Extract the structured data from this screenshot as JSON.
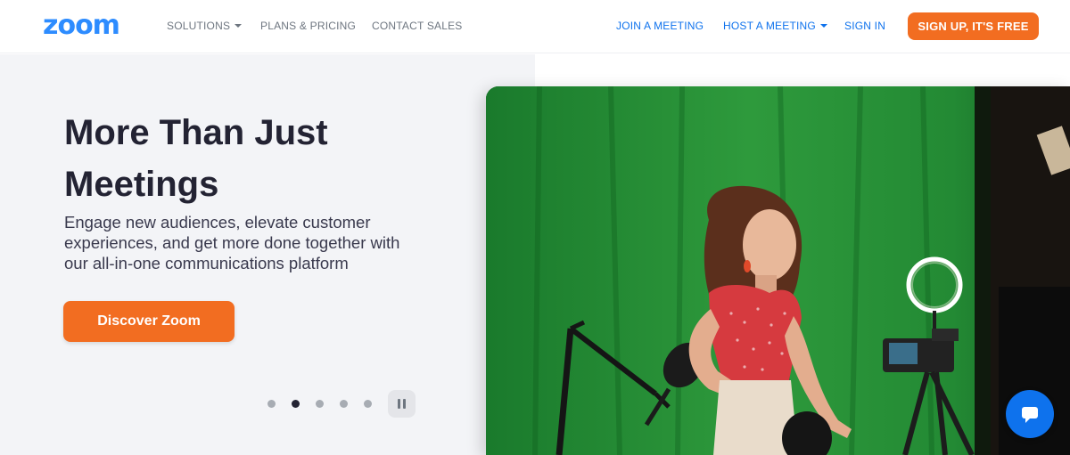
{
  "nav": {
    "logo": "zoom",
    "solutions": "SOLUTIONS",
    "plans": "PLANS & PRICING",
    "contact": "CONTACT SALES",
    "join": "JOIN A MEETING",
    "host": "HOST A MEETING",
    "signin": "SIGN IN",
    "signup": "SIGN UP, IT'S FREE"
  },
  "hero": {
    "headline": "More Than Just Meetings",
    "subtext": "Engage new audiences, elevate customer experiences, and get more done together with our all-in-one communications platform",
    "cta": "Discover Zoom"
  },
  "carousel": {
    "slide_count": 5,
    "active_slide": 2,
    "pause_icon": "pause-icon"
  },
  "media": {
    "scene": "woman-at-green-screen-with-ring-light-and-microphone"
  },
  "chat": {
    "icon": "chat-bubble-icon"
  },
  "colors": {
    "brand_blue": "#2d8cff",
    "link_blue": "#0e72ed",
    "cta_orange": "#f26d21",
    "nav_grey": "#6e7680",
    "hero_bg": "#f3f4f7",
    "headline": "#232333"
  }
}
